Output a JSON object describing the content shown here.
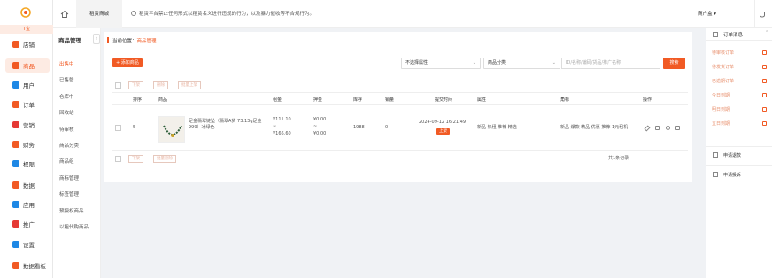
{
  "colors": {
    "accent": "#f15a24",
    "accent_light": "#fdebe3"
  },
  "sidebar": {
    "mini_label": "T宝",
    "items": [
      {
        "label": "店铺",
        "icon": "store-icon",
        "color": "#f15a24"
      },
      {
        "label": "商品",
        "icon": "goods-icon",
        "color": "#f15a24"
      },
      {
        "label": "用户",
        "icon": "user-icon",
        "color": "#1e88e5"
      },
      {
        "label": "订单",
        "icon": "order-icon",
        "color": "#f15a24"
      },
      {
        "label": "营销",
        "icon": "marketing-icon",
        "color": "#e53935"
      },
      {
        "label": "财务",
        "icon": "finance-icon",
        "color": "#f15a24"
      },
      {
        "label": "权限",
        "icon": "permission-icon",
        "color": "#1e88e5"
      },
      {
        "label": "数据",
        "icon": "data-icon",
        "color": "#f15a24"
      },
      {
        "label": "应用",
        "icon": "app-icon",
        "color": "#1e88e5"
      },
      {
        "label": "推广",
        "icon": "promote-icon",
        "color": "#e53935"
      },
      {
        "label": "设置",
        "icon": "settings-icon",
        "color": "#1e88e5"
      },
      {
        "label": "数据看板",
        "icon": "dashboard-icon",
        "color": "#f15a24"
      }
    ]
  },
  "submenu": {
    "title": "商品管理",
    "items": [
      "出售中",
      "已售罄",
      "仓库中",
      "回收站",
      "待审核",
      "商品分类",
      "商品组",
      "商标管理",
      "标签管理",
      "预授权商品",
      "以租代购商品"
    ]
  },
  "topbar": {
    "tab": "租赁商城",
    "notice": "租赁平台禁止任何形式以租赁名义进行违规的行为，以及暴力催收等不合规行为。",
    "shop": "商户盒 ▾"
  },
  "main": {
    "breadcrumb_prefix": "当前位置：",
    "breadcrumb_current": "商品管理",
    "add_button": "+ 添加商品",
    "filter1": "不选择属性",
    "filter2": "商品分类",
    "search_placeholder": "ID/名称/编码/货品/推广名称",
    "search_button": "搜索",
    "batch_buttons": [
      "下架",
      "删除",
      "批量上架"
    ],
    "columns": [
      "排序",
      "商品",
      "租金",
      "押金",
      "库存",
      "销量",
      "提交时间",
      "属性",
      "角标",
      "操作"
    ],
    "rows": [
      {
        "sort": "5",
        "name": "足金翡翠链坠（翡翠A货 73.13g足金999）冰绿色",
        "rent_high": "¥111.10",
        "rent_sep": "~",
        "rent_low": "¥166.60",
        "deposit_high": "¥0.00",
        "deposit_sep": "~",
        "deposit_low": "¥0.00",
        "stock": "1988",
        "sales": "0",
        "time": "2024-09-12 16:21:49",
        "status": "上架",
        "attrs": "新品 热租 推荐 精选",
        "tags": "新品 爆款 精品 优惠 推荐 1元租机"
      }
    ],
    "bottom_buttons": [
      "下架",
      "批量删除"
    ],
    "total": "共1条记录"
  },
  "right_panel": {
    "title": "订单消息",
    "items": [
      "待审核订单",
      "待发货订单",
      "已逾期订单",
      "今日到期",
      "明日到期",
      "五日到期"
    ],
    "links": [
      "申请退款",
      "申请投诉"
    ]
  }
}
